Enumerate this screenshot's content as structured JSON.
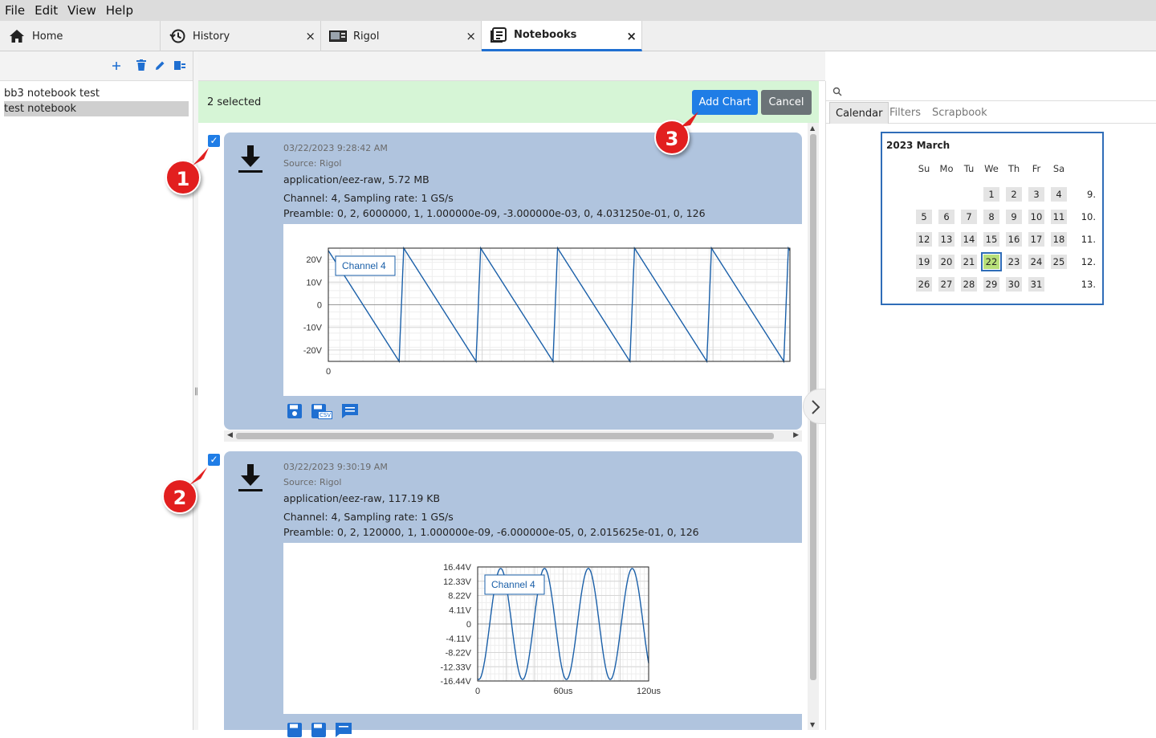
{
  "menu": [
    "File",
    "Edit",
    "View",
    "Help"
  ],
  "tabs": [
    {
      "label": "Home",
      "icon": "home-icon",
      "closable": false,
      "active": false
    },
    {
      "label": "History",
      "icon": "history-icon",
      "closable": true,
      "active": false
    },
    {
      "label": "Rigol",
      "icon": "oscilloscope-icon",
      "closable": true,
      "active": false
    },
    {
      "label": "Notebooks",
      "icon": "notebook-icon",
      "closable": true,
      "active": true
    }
  ],
  "close_glyph": "×",
  "left": {
    "toolbar": [
      "add-icon",
      "delete-icon",
      "edit-icon",
      "notebook-settings-icon"
    ],
    "notebooks": [
      {
        "label": "bb3 notebook test",
        "selected": false
      },
      {
        "label": "test notebook",
        "selected": true
      }
    ]
  },
  "selection": {
    "count_label": "2 selected",
    "add_chart_label": "Add Chart",
    "cancel_label": "Cancel"
  },
  "markers": [
    "1",
    "2",
    "3"
  ],
  "items": [
    {
      "checked": true,
      "date": "03/22/2023 9:28:42 AM",
      "source": "Source: Rigol",
      "type": "application/eez-raw, 5.72 MB",
      "channel": "Channel: 4, Sampling rate: 1 GS/s",
      "preamble": "Preamble: 0, 2, 6000000, 1, 1.000000e-09, -3.000000e-03, 0, 4.031250e-01, 0, 126",
      "icons": [
        "save-icon",
        "save-csv-icon",
        "comment-icon"
      ],
      "csv_badge": "CSV"
    },
    {
      "checked": true,
      "date": "03/22/2023 9:30:19 AM",
      "source": "Source: Rigol",
      "type": "application/eez-raw, 117.19 KB",
      "channel": "Channel: 4, Sampling rate: 1 GS/s",
      "preamble": "Preamble: 0, 2, 120000, 1, 1.000000e-09, -6.000000e-05, 0, 2.015625e-01, 0, 126",
      "icons": [
        "save-icon",
        "save-csv-icon",
        "comment-icon"
      ]
    }
  ],
  "chart_data": [
    {
      "type": "line",
      "legend": "Channel 4",
      "y_ticks": [
        "20V",
        "10V",
        "0",
        "-10V",
        "-20V"
      ],
      "x_ticks": [
        "0"
      ],
      "ylim": [
        -25,
        25
      ],
      "series": [
        {
          "name": "Channel 4",
          "waveform": "sawtooth",
          "periods": 6,
          "peak": 25,
          "color": "#1a5fa8"
        }
      ]
    },
    {
      "type": "line",
      "legend": "Channel 4",
      "y_ticks": [
        "16.44V",
        "12.33V",
        "8.22V",
        "4.11V",
        "0",
        "-4.11V",
        "-8.22V",
        "-12.33V",
        "-16.44V"
      ],
      "x_ticks": [
        "0",
        "60us",
        "120us"
      ],
      "ylim": [
        -16.44,
        16.44
      ],
      "series": [
        {
          "name": "Channel 4",
          "waveform": "sine",
          "periods": 3.9,
          "amplitude": 16.0,
          "color": "#1a5fa8"
        }
      ]
    }
  ],
  "right": {
    "search_icon": "search-icon",
    "tabs": [
      {
        "label": "Calendar",
        "active": true
      },
      {
        "label": "Filters",
        "active": false
      },
      {
        "label": "Scrapbook",
        "active": false
      }
    ],
    "calendar": {
      "title": "2023 March",
      "dow": [
        "Su",
        "Mo",
        "Tu",
        "We",
        "Th",
        "Fr",
        "Sa"
      ],
      "weeks": [
        {
          "days": [
            "",
            "",
            "",
            "1",
            "2",
            "3",
            "4"
          ],
          "week": "9."
        },
        {
          "days": [
            "5",
            "6",
            "7",
            "8",
            "9",
            "10",
            "11"
          ],
          "week": "10."
        },
        {
          "days": [
            "12",
            "13",
            "14",
            "15",
            "16",
            "17",
            "18"
          ],
          "week": "11."
        },
        {
          "days": [
            "19",
            "20",
            "21",
            "22",
            "23",
            "24",
            "25"
          ],
          "week": "12."
        },
        {
          "days": [
            "26",
            "27",
            "28",
            "29",
            "30",
            "31",
            ""
          ],
          "week": "13."
        }
      ],
      "today": "22"
    }
  }
}
